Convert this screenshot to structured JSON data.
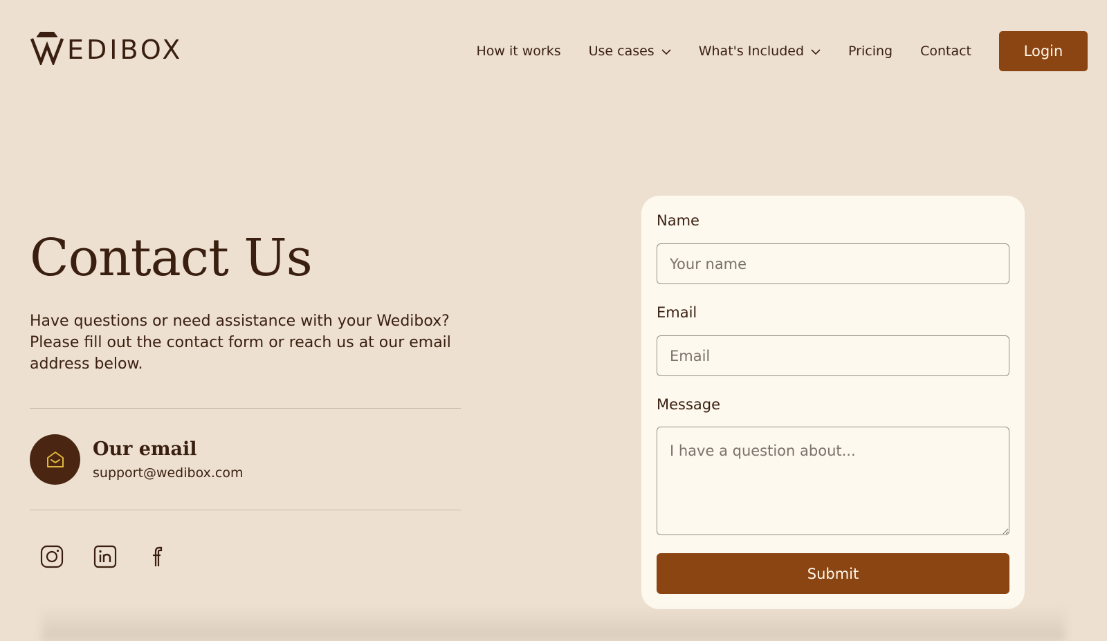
{
  "brand": {
    "name": "EDIBOX"
  },
  "nav": {
    "items": [
      {
        "label": "How it works",
        "dropdown": false
      },
      {
        "label": "Use cases",
        "dropdown": true
      },
      {
        "label": "What's Included",
        "dropdown": true
      },
      {
        "label": "Pricing",
        "dropdown": false
      },
      {
        "label": "Contact",
        "dropdown": false
      }
    ],
    "login_label": "Login"
  },
  "hero": {
    "title": "Contact Us",
    "description": "Have questions or need assistance with your Wedibox? Please fill out the contact form or reach us at our email address below."
  },
  "contact": {
    "email_heading": "Our email",
    "email_address": "support@wedibox.com"
  },
  "socials": [
    "instagram-icon",
    "linkedin-icon",
    "facebook-icon"
  ],
  "form": {
    "name_label": "Name",
    "name_placeholder": "Your name",
    "email_label": "Email",
    "email_placeholder": "Email",
    "message_label": "Message",
    "message_placeholder": "I have a question about...",
    "submit_label": "Submit"
  },
  "colors": {
    "background": "#ede0d0",
    "card": "#fdf9ef",
    "accent": "#8b4513",
    "text": "#3a1f10",
    "icon_gold": "#e0b63c"
  }
}
